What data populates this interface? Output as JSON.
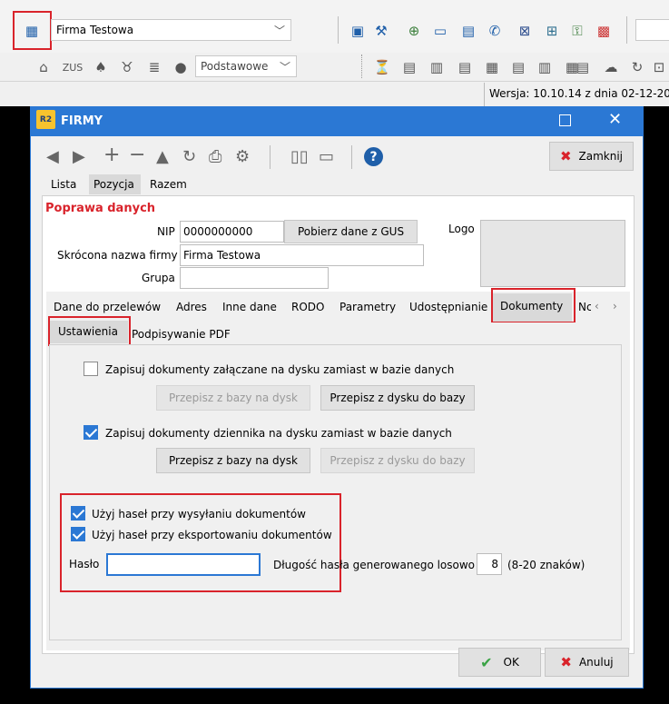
{
  "toolbar": {
    "company_combo": "Firma Testowa",
    "mode_combo": "Podstawowe",
    "version": "Wersja: 10.10.14 z dnia 02-12-20"
  },
  "dialog": {
    "title": "FIRMY",
    "close_label": "Zamknij",
    "view_tabs": [
      "Lista",
      "Pozycja",
      "Razem"
    ],
    "section_title": "Poprawa danych",
    "nip_label": "NIP",
    "nip_value": "0000000000",
    "gus_button": "Pobierz dane z GUS",
    "logo_label": "Logo",
    "short_name_label": "Skrócona nazwa firmy",
    "short_name_value": "Firma Testowa",
    "group_label": "Grupa",
    "group_value": "",
    "detail_tabs": [
      "Dane do przelewów",
      "Adres",
      "Inne dane",
      "RODO",
      "Parametry",
      "Udostępnianie",
      "Dokumenty",
      "Nc"
    ],
    "sub_tabs": [
      "Ustawienia",
      "Podpisywanie PDF"
    ],
    "opt1_label": "Zapisuj dokumenty załączane na dysku zamiast w bazie danych",
    "opt1_checked": false,
    "btn_db_to_disk": "Przepisz z bazy na dysk",
    "btn_disk_to_db": "Przepisz z dysku do bazy",
    "opt2_label": "Zapisuj dokumenty dziennika na dysku zamiast w bazie danych",
    "opt2_checked": true,
    "opt3_label": "Użyj haseł przy wysyłaniu dokumentów",
    "opt3_checked": true,
    "opt4_label": "Użyj haseł przy eksportowaniu dokumentów",
    "opt4_checked": true,
    "password_label": "Hasło",
    "password_value": "",
    "pw_length_label": "Długość hasła generowanego losowo",
    "pw_length_value": "8",
    "pw_length_hint": "(8-20 znaków)",
    "ok_label": "OK",
    "cancel_label": "Anuluj"
  }
}
